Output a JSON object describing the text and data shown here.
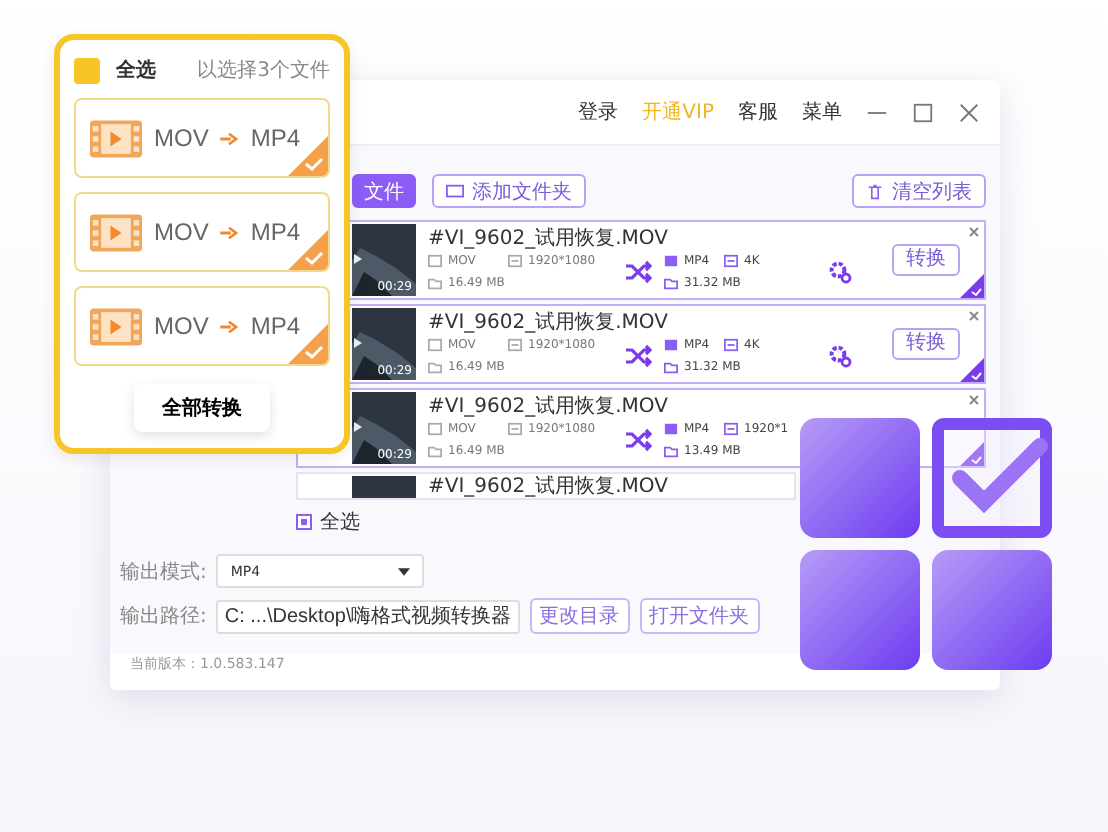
{
  "summary_card": {
    "select_all": {
      "label": "全选",
      "checked": true
    },
    "count_text": "以选择3个文件",
    "items": [
      {
        "from": "MOV",
        "to": "MP4",
        "checked": true
      },
      {
        "from": "MOV",
        "to": "MP4",
        "checked": true
      },
      {
        "from": "MOV",
        "to": "MP4",
        "checked": true
      }
    ],
    "button": "全部转换"
  },
  "window": {
    "menu": [
      {
        "label": "登录",
        "highlight": false
      },
      {
        "label": "开通VIP",
        "highlight": true
      },
      {
        "label": "客服",
        "highlight": false
      },
      {
        "label": "菜单",
        "highlight": false
      }
    ],
    "toolbar": {
      "add_file": "文件",
      "add_folder": "添加文件夹",
      "clear": "清空列表"
    },
    "files": [
      {
        "kind": "full",
        "name": "#VI_9602_试用恢复.MOV",
        "duration": "00:29",
        "format": "MOV",
        "resolution": "1920*1080",
        "size": "16.49 MB",
        "out_format": "MP4",
        "out_resolution": "4K",
        "out_size": "31.32 MB",
        "button": "转换",
        "checked": true
      },
      {
        "kind": "full",
        "name": "#VI_9602_试用恢复.MOV",
        "duration": "00:29",
        "format": "MOV",
        "resolution": "1920*1080",
        "size": "16.49 MB",
        "out_format": "MP4",
        "out_resolution": "4K",
        "out_size": "31.32 MB",
        "button": "转换",
        "checked": true
      },
      {
        "kind": "covered",
        "name": "#VI_9602_试用恢复.MOV",
        "duration": "00:29",
        "format": "MOV",
        "resolution": "1920*1080",
        "size": "16.49 MB",
        "out_format": "MP4",
        "out_resolution": "1920*1",
        "out_size": "13.49 MB",
        "checked": true
      },
      {
        "kind": "partial",
        "name": "#VI_9602_试用恢复.MOV",
        "checked": false
      }
    ],
    "select_all": {
      "label": "全选",
      "checked": true
    },
    "output_format": {
      "label": "输出模式:",
      "value": "MP4"
    },
    "output_path": {
      "label": "输出路径:",
      "value": "C: ...\\Desktop\\嗨格式视频转换器"
    },
    "path_buttons": [
      "更改目录",
      "打开文件夹"
    ],
    "version": "当前版本：1.0.583.147"
  }
}
